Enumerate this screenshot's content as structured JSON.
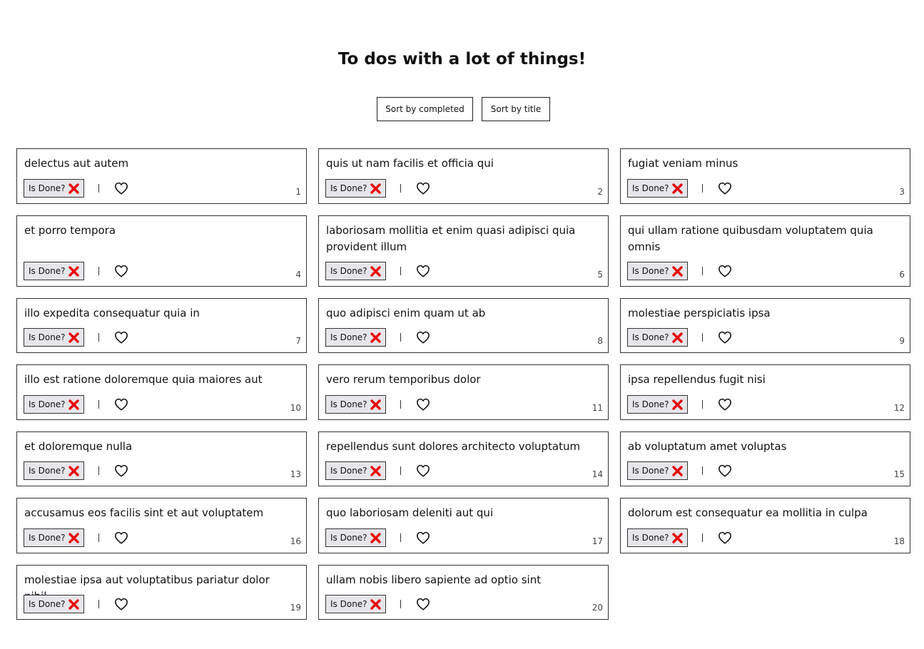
{
  "page": {
    "title": "To dos with a lot of things!"
  },
  "sort": {
    "completed_label": "Sort by completed",
    "title_label": "Sort by title"
  },
  "done_label": "Is Done?",
  "colors": {
    "cross": "#e8000b",
    "border": "#333333",
    "done_bg": "#e6e6ea"
  },
  "icons": {
    "not_done": "cross-icon",
    "favorite": "heart-outline-icon"
  },
  "todos": [
    {
      "id": "1",
      "title": "delectus aut autem",
      "completed": false,
      "favorite": false
    },
    {
      "id": "2",
      "title": "quis ut nam facilis et officia qui",
      "completed": false,
      "favorite": false
    },
    {
      "id": "3",
      "title": "fugiat veniam minus",
      "completed": false,
      "favorite": false
    },
    {
      "id": "4",
      "title": "et porro tempora",
      "completed": false,
      "favorite": false
    },
    {
      "id": "5",
      "title": "laboriosam mollitia et enim quasi adipisci quia provident illum",
      "completed": false,
      "favorite": false
    },
    {
      "id": "6",
      "title": "qui ullam ratione quibusdam voluptatem quia omnis",
      "completed": false,
      "favorite": false
    },
    {
      "id": "7",
      "title": "illo expedita consequatur quia in",
      "completed": false,
      "favorite": false
    },
    {
      "id": "8",
      "title": "quo adipisci enim quam ut ab",
      "completed": false,
      "favorite": false
    },
    {
      "id": "9",
      "title": "molestiae perspiciatis ipsa",
      "completed": false,
      "favorite": false
    },
    {
      "id": "10",
      "title": "illo est ratione doloremque quia maiores aut",
      "completed": false,
      "favorite": false
    },
    {
      "id": "11",
      "title": "vero rerum temporibus dolor",
      "completed": false,
      "favorite": false
    },
    {
      "id": "12",
      "title": "ipsa repellendus fugit nisi",
      "completed": false,
      "favorite": false
    },
    {
      "id": "13",
      "title": "et doloremque nulla",
      "completed": false,
      "favorite": false
    },
    {
      "id": "14",
      "title": "repellendus sunt dolores architecto voluptatum",
      "completed": false,
      "favorite": false
    },
    {
      "id": "15",
      "title": "ab voluptatum amet voluptas",
      "completed": false,
      "favorite": false
    },
    {
      "id": "16",
      "title": "accusamus eos facilis sint et aut voluptatem",
      "completed": false,
      "favorite": false
    },
    {
      "id": "17",
      "title": "quo laboriosam deleniti aut qui",
      "completed": false,
      "favorite": false
    },
    {
      "id": "18",
      "title": "dolorum est consequatur ea mollitia in culpa",
      "completed": false,
      "favorite": false
    },
    {
      "id": "19",
      "title": "molestiae ipsa aut voluptatibus pariatur dolor nihil",
      "completed": false,
      "favorite": false
    },
    {
      "id": "20",
      "title": "ullam nobis libero sapiente ad optio sint",
      "completed": false,
      "favorite": false
    }
  ]
}
